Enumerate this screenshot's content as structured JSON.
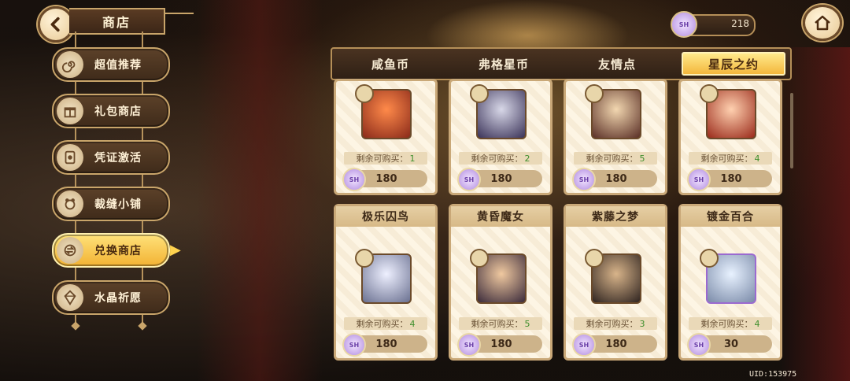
{
  "header": {
    "title": "商店"
  },
  "sidebar": {
    "items": [
      {
        "label": "超值推荐",
        "icon": "spiral-icon"
      },
      {
        "label": "礼包商店",
        "icon": "gift-box-icon"
      },
      {
        "label": "凭证激活",
        "icon": "ticket-icon"
      },
      {
        "label": "裁缝小铺",
        "icon": "tailor-icon"
      },
      {
        "label": "兑换商店",
        "icon": "exchange-icon",
        "active": true
      },
      {
        "label": "水晶祈愿",
        "icon": "crystal-icon"
      }
    ]
  },
  "currency": {
    "value": "218",
    "icon": "star-crystal-icon"
  },
  "tabs": [
    {
      "label": "咸鱼币"
    },
    {
      "label": "弗格星币"
    },
    {
      "label": "友情点"
    },
    {
      "label": "星辰之约",
      "active": true
    }
  ],
  "cards_top": [
    {
      "remain_label": "剩余可购买：",
      "remain": "1",
      "price": "180"
    },
    {
      "remain_label": "剩余可购买：",
      "remain": "2",
      "price": "180"
    },
    {
      "remain_label": "剩余可购买：",
      "remain": "5",
      "price": "180"
    },
    {
      "remain_label": "剩余可购买：",
      "remain": "4",
      "price": "180"
    }
  ],
  "cards_bottom": [
    {
      "name": "极乐囚鸟",
      "remain_label": "剩余可购买：",
      "remain": "4",
      "price": "180"
    },
    {
      "name": "黄昏魔女",
      "remain_label": "剩余可购买：",
      "remain": "5",
      "price": "180"
    },
    {
      "name": "紫藤之梦",
      "remain_label": "剩余可购买：",
      "remain": "3",
      "price": "180"
    },
    {
      "name": "镀金百合",
      "remain_label": "剩余可购买：",
      "remain": "4",
      "price": "30"
    }
  ],
  "price_icon_text": "SH",
  "uid": "UID:153975",
  "colors": {
    "active_gold": "#f3b73c",
    "panel_brown": "#3f2b1a",
    "card_bg": "#fdf5e4",
    "remain_green": "#3f8f2d"
  }
}
